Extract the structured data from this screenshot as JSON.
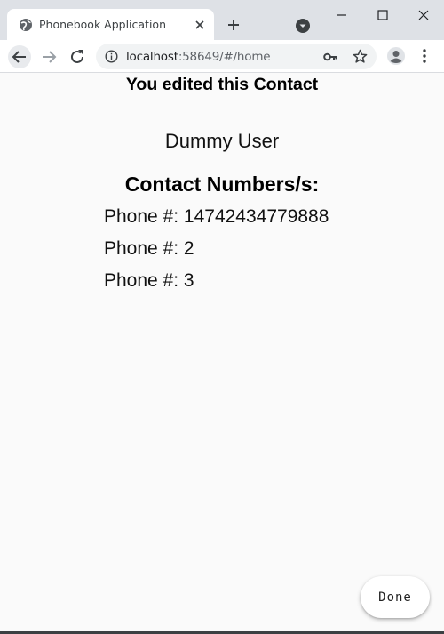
{
  "browser": {
    "tab_title": "Phonebook Application",
    "url_host": "localhost",
    "url_path": ":58649/#/home"
  },
  "page": {
    "heading": "You edited this Contact",
    "contact_name": "Dummy User",
    "numbers_label": "Contact Numbers/s:",
    "phones": [
      "Phone #: 14742434779888",
      "Phone #: 2",
      "Phone #: 3"
    ],
    "done_label": "Done"
  }
}
